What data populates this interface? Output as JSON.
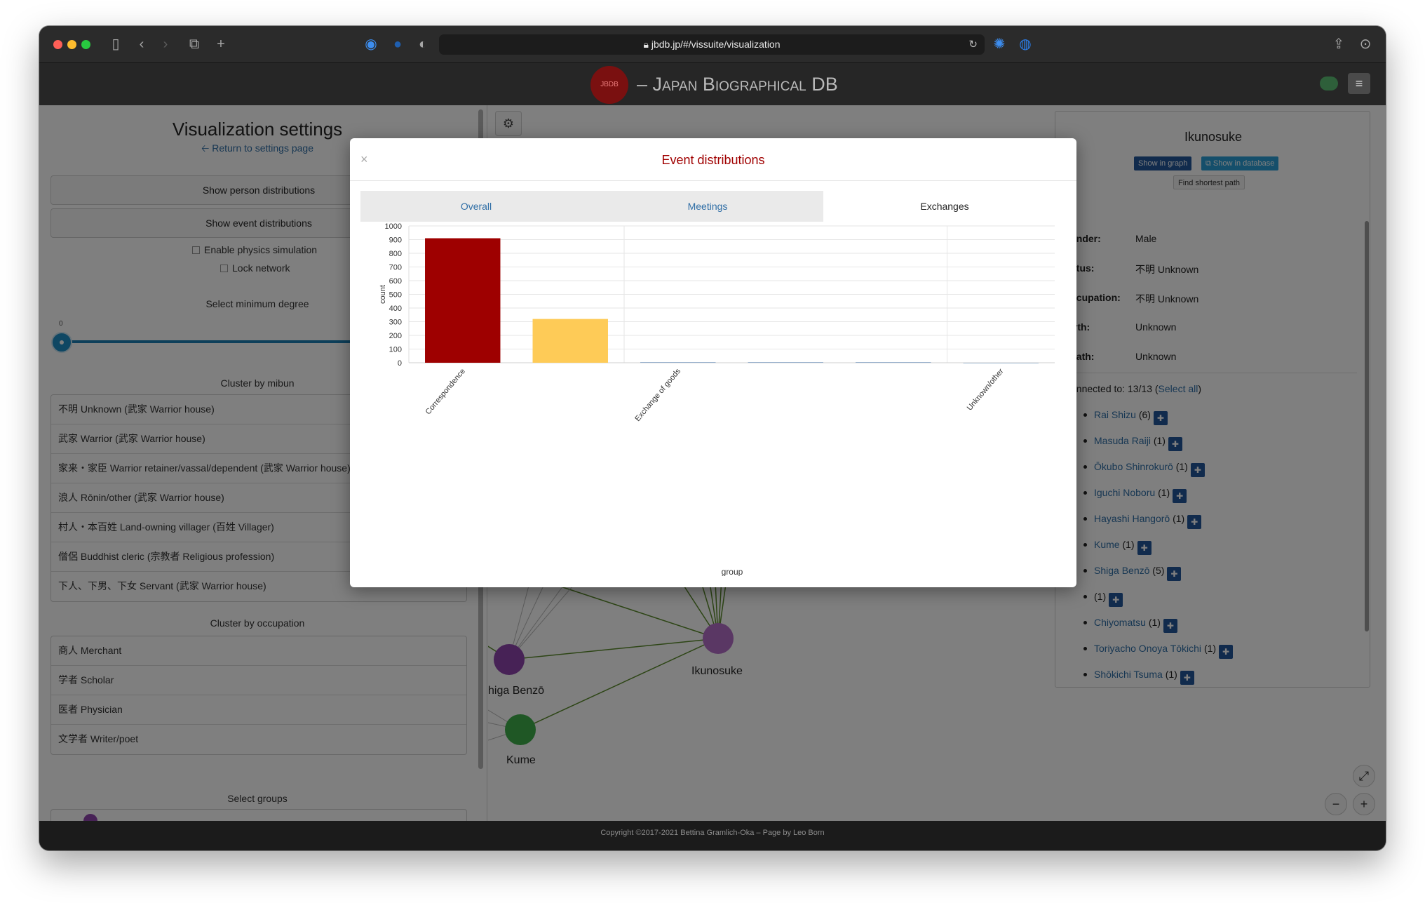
{
  "browser": {
    "url": "jbdb.jp/#/vissuite/visualization"
  },
  "app": {
    "logo_text": "JBDB",
    "brand": "– Japan Biographical DB",
    "footer": "Copyright ©2017-2021 Bettina Gramlich-Oka – Page by Leo Born"
  },
  "left_panel": {
    "title": "Visualization settings",
    "return_link": "🡠 Return to settings page",
    "show_person_distributions": "Show person distributions",
    "show_event_distributions": "Show event distributions",
    "enable_physics": "Enable physics simulation",
    "lock_network": "Lock network",
    "min_degree_title": "Select minimum degree",
    "min_degree_value": "0",
    "cluster_mibun_title": "Cluster by mibun",
    "mibun_items": [
      "不明 Unknown (武家 Warrior house)",
      "武家 Warrior (武家 Warrior house)",
      "家来・家臣 Warrior retainer/vassal/dependent (武家 Warrior house)",
      "浪人 Rōnin/other (武家 Warrior house)",
      "村人・本百姓 Land-owning villager (百姓 Villager)",
      "僧侶 Buddhist cleric (宗教者 Religious profession)",
      "下人、下男、下女 Servant (武家 Warrior house)"
    ],
    "cluster_occupation_title": "Cluster by occupation",
    "occupation_items": [
      "商人 Merchant",
      "学者 Scholar",
      "医者 Physician",
      "文学者 Writer/poet"
    ],
    "select_groups_title": "Select groups"
  },
  "graph": {
    "node_labels": {
      "ikunosuke": "Ikunosuke",
      "shiga": "higa Benzō",
      "kume": "Kume"
    },
    "colors": {
      "purple_node": "#b46fc8",
      "violet_node": "#8e44ad",
      "green_node": "#3fae4a",
      "edge": "#5a8a2a"
    }
  },
  "info_panel": {
    "name": "Ikunosuke",
    "show_in_graph": "Show in graph",
    "show_in_database": "Show in database",
    "find_shortest_path": "Find shortest path",
    "fields": [
      {
        "label": "ender:",
        "value": "Male"
      },
      {
        "label": "atus:",
        "value": "不明 Unknown"
      },
      {
        "label": "ccupation:",
        "value": "不明 Unknown"
      },
      {
        "label": "irth:",
        "value": "Unknown"
      },
      {
        "label": "eath:",
        "value": "Unknown"
      }
    ],
    "connected_label": "onnected to: 13/13 (",
    "select_all": "Select all",
    "connected_close": ")",
    "connections": [
      {
        "name": "Rai Shizu",
        "count": "(6)"
      },
      {
        "name": "Masuda Raiji",
        "count": "(1)"
      },
      {
        "name": "Ōkubo Shinrokurō",
        "count": "(1)"
      },
      {
        "name": "Iguchi Noboru",
        "count": "(1)"
      },
      {
        "name": "Hayashi Hangorō",
        "count": "(1)"
      },
      {
        "name": "Kume",
        "count": "(1)"
      },
      {
        "name": "Shiga Benzō",
        "count": "(5)"
      },
      {
        "name": "",
        "count": "(1)"
      },
      {
        "name": "Chiyomatsu",
        "count": "(1)"
      },
      {
        "name": "Toriyacho Onoya Tōkichi",
        "count": "(1)"
      },
      {
        "name": "Shōkichi Tsuma",
        "count": "(1)"
      }
    ]
  },
  "modal": {
    "title": "Event distributions",
    "close": "×",
    "tabs": [
      {
        "label": "Overall",
        "active": false
      },
      {
        "label": "Meetings",
        "active": false
      },
      {
        "label": "Exchanges",
        "active": true
      }
    ]
  },
  "chart_data": {
    "type": "bar",
    "categories": [
      "Correspondence",
      "",
      "Exchange of goods",
      "",
      "",
      "Unknown/other"
    ],
    "values": [
      910,
      320,
      3,
      3,
      3,
      0
    ],
    "colors": [
      "#9e0000",
      "#fecb57",
      "#4e79a7",
      "#4e79a7",
      "#4e79a7",
      "#4e79a7"
    ],
    "xlabel": "group",
    "ylabel": "count",
    "ylim": [
      0,
      1000
    ],
    "yticks": [
      0,
      100,
      200,
      300,
      400,
      500,
      600,
      700,
      800,
      900,
      1000
    ],
    "grid": true
  }
}
